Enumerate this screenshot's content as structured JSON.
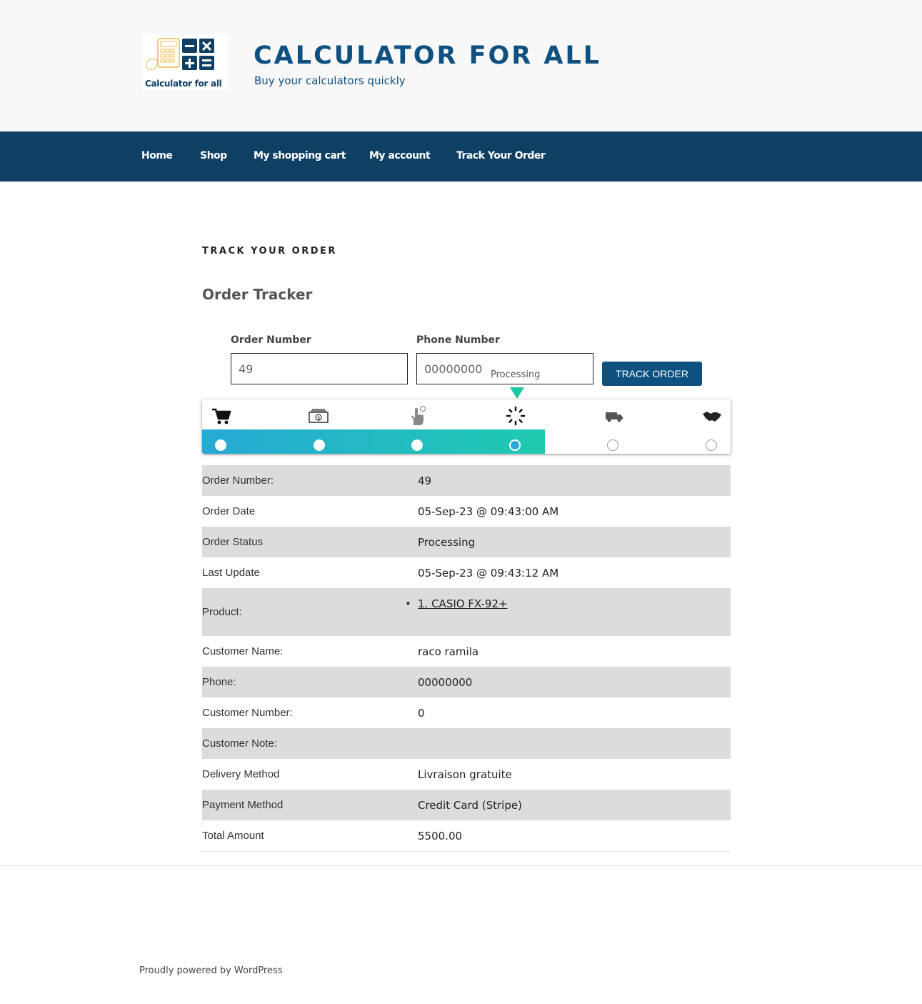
{
  "header": {
    "logo_text": "Calculator for all",
    "site_title": "CALCULATOR FOR ALL",
    "tagline": "Buy your calculators quickly"
  },
  "nav": {
    "items": [
      {
        "label": "Home"
      },
      {
        "label": "Shop"
      },
      {
        "label": "My shopping cart"
      },
      {
        "label": "My account"
      },
      {
        "label": "Track Your Order"
      }
    ]
  },
  "page": {
    "title": "TRACK YOUR ORDER",
    "tracker_title": "Order Tracker"
  },
  "form": {
    "order_label": "Order Number",
    "order_value": "49",
    "phone_label": "Phone Number",
    "phone_value": "00000000",
    "status_hint": "Processing",
    "button_label": "TRACK ORDER"
  },
  "progress": {
    "steps": [
      {
        "icon": "cart-icon"
      },
      {
        "icon": "cash-icon"
      },
      {
        "icon": "hand-tap-icon"
      },
      {
        "icon": "spinner-icon"
      },
      {
        "icon": "truck-icon"
      },
      {
        "icon": "handshake-icon"
      }
    ],
    "current_step": 4,
    "colors": {
      "start": "#27a9d6",
      "end": "#1fcab0"
    }
  },
  "details": {
    "rows": [
      {
        "label": "Order Number:",
        "value": "49"
      },
      {
        "label": "Order Date",
        "value": "05-Sep-23 @ 09:43:00 AM"
      },
      {
        "label": "Order Status",
        "value": "Processing"
      },
      {
        "label": "Last Update",
        "value": "05-Sep-23 @ 09:43:12 AM"
      },
      {
        "label": "Product:",
        "value": "1. CASIO FX-92+"
      },
      {
        "label": "Customer Name:",
        "value": "raco ramila"
      },
      {
        "label": "Phone:",
        "value": "00000000"
      },
      {
        "label": "Customer Number:",
        "value": "0"
      },
      {
        "label": "Customer Note:",
        "value": ""
      },
      {
        "label": "Delivery Method",
        "value": "Livraison gratuite"
      },
      {
        "label": "Payment Method",
        "value": "Credit Card (Stripe)"
      },
      {
        "label": "Total Amount",
        "value": "5500.00"
      }
    ]
  },
  "footer": {
    "text": "Proudly powered by WordPress"
  },
  "colors": {
    "brand": "#0e5080",
    "nav_bg": "#0f3f63",
    "row_alt": "#dcdcdc"
  }
}
